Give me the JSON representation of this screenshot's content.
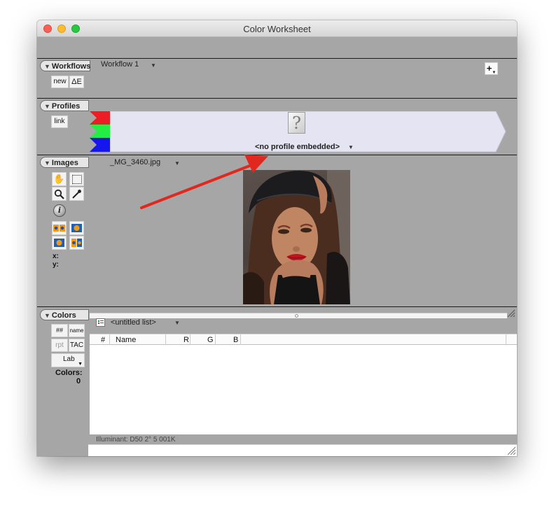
{
  "window": {
    "title": "Color Worksheet"
  },
  "workflows": {
    "tab_label": "Workflows",
    "selected": "Workflow 1",
    "buttons": {
      "new": "new",
      "delta_e": "ΔE"
    },
    "add_label": "+"
  },
  "profiles": {
    "tab_label": "Profiles",
    "link_label": "link",
    "profile_name": "<no profile embedded>"
  },
  "images": {
    "tab_label": "Images",
    "selected": "_MG_3460.jpg",
    "coord_x_label": "x:",
    "coord_y_label": "y:"
  },
  "colors": {
    "tab_label": "Colors",
    "buttons": {
      "hash": "##",
      "name": "name",
      "rpt": "rpt",
      "tac": "TAC",
      "mode": "Lab"
    },
    "count_label": "Colors:",
    "count_value": "0",
    "list_name": "<untitled list>",
    "table_headers": [
      "#",
      "Name",
      "R",
      "G",
      "B"
    ],
    "illuminant": "Illuminant: D50 2° 5 001K"
  },
  "colors_palette": {
    "red": "#ee1c24",
    "green": "#22ee44",
    "blue": "#1515ee",
    "profile_bar": "#e4e4f2",
    "annotation_arrow": "#e0281e"
  }
}
